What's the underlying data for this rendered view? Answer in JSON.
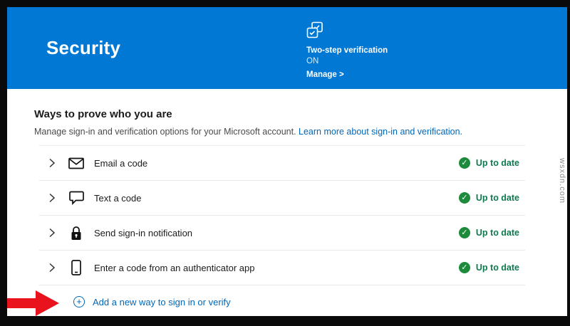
{
  "watermark": "wsxdn.com",
  "header": {
    "title": "Security",
    "two_step": {
      "title": "Two-step verification",
      "status": "ON",
      "manage_label": "Manage >"
    }
  },
  "main": {
    "heading": "Ways to prove who you are",
    "subtext": "Manage sign-in and verification options for your Microsoft account. ",
    "learn_more": "Learn more about sign-in and verification.",
    "rows": [
      {
        "icon": "envelope-icon",
        "label": "Email a code",
        "status": "Up to date"
      },
      {
        "icon": "chat-icon",
        "label": "Text a code",
        "status": "Up to date"
      },
      {
        "icon": "lock-icon",
        "label": "Send sign-in notification",
        "status": "Up to date"
      },
      {
        "icon": "phone-icon",
        "label": "Enter a code from an authenticator app",
        "status": "Up to date"
      }
    ],
    "add_link": "Add a new way to sign in or verify"
  },
  "colors": {
    "header_bg": "#0078d4",
    "link_blue": "#0067b8",
    "status_green": "#0e7a4f",
    "arrow_red": "#e8131d",
    "frame_black": "#0a0a0a"
  }
}
